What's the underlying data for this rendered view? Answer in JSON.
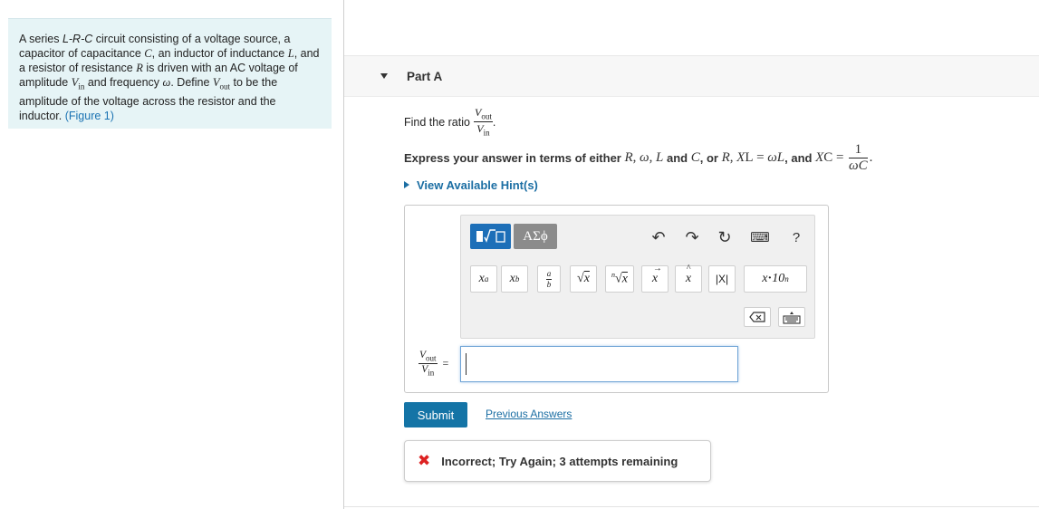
{
  "intro": {
    "t1": "A series ",
    "circuit": "L-R-C",
    "t2": " circuit consisting of a voltage source, a capacitor of capacitance ",
    "C": "C",
    "t3": ", an inductor of inductance ",
    "L": "L",
    "t4": ", and a resistor of resistance ",
    "R": "R",
    "t5": " is driven with an AC voltage of amplitude ",
    "V": "V",
    "in": "in",
    "t6": " and frequency ",
    "omega": "ω",
    "t7": ". Define ",
    "out": "out",
    "t8": " to be the amplitude of the voltage across the resistor and the inductor. ",
    "figure_link": "(Figure 1)"
  },
  "part": {
    "title": "Part A"
  },
  "question": {
    "find_label": "Find the ratio",
    "V": "V",
    "out": "out",
    "in": "in",
    "period": "."
  },
  "express": {
    "t1": "Express your answer in terms of either",
    "R": "R",
    "c1": ",",
    "omega": "ω",
    "c2": ",",
    "L": "L",
    "and1": "and",
    "C": "C",
    "c3": ", or",
    "R2": "R",
    "c4": ",",
    "XL": "X",
    "L_sub": "L",
    "eq1": "=",
    "wL": "ωL",
    "c5": ", and",
    "XC": "X",
    "C_sub": "C",
    "eq2": "=",
    "one": "1",
    "wC": "ωC",
    "end": "."
  },
  "hints": {
    "label": "View Available Hint(s)"
  },
  "toolbar": {
    "templates_label": "▮√□",
    "greek_label": "ΑΣϕ",
    "undo": "↶",
    "redo": "↷",
    "reset": "↻",
    "keyboard": "⌨",
    "help": "?",
    "symbols": [
      "xᵃ",
      "x_b",
      "a/b",
      "√x",
      "ⁿ√x",
      "x⃗",
      "x̂",
      "|X|",
      "x·10ⁿ"
    ],
    "backspace": "⌫",
    "keyboard2": "⌨"
  },
  "answer": {
    "lhs_V": "V",
    "lhs_out": "out",
    "lhs_in": "in",
    "equals": "=",
    "value": ""
  },
  "actions": {
    "submit_label": "Submit",
    "previous_label": "Previous Answers"
  },
  "feedback": {
    "icon": "✖",
    "text": "Incorrect; Try Again; 3 attempts remaining",
    "color": "#dd2222"
  }
}
